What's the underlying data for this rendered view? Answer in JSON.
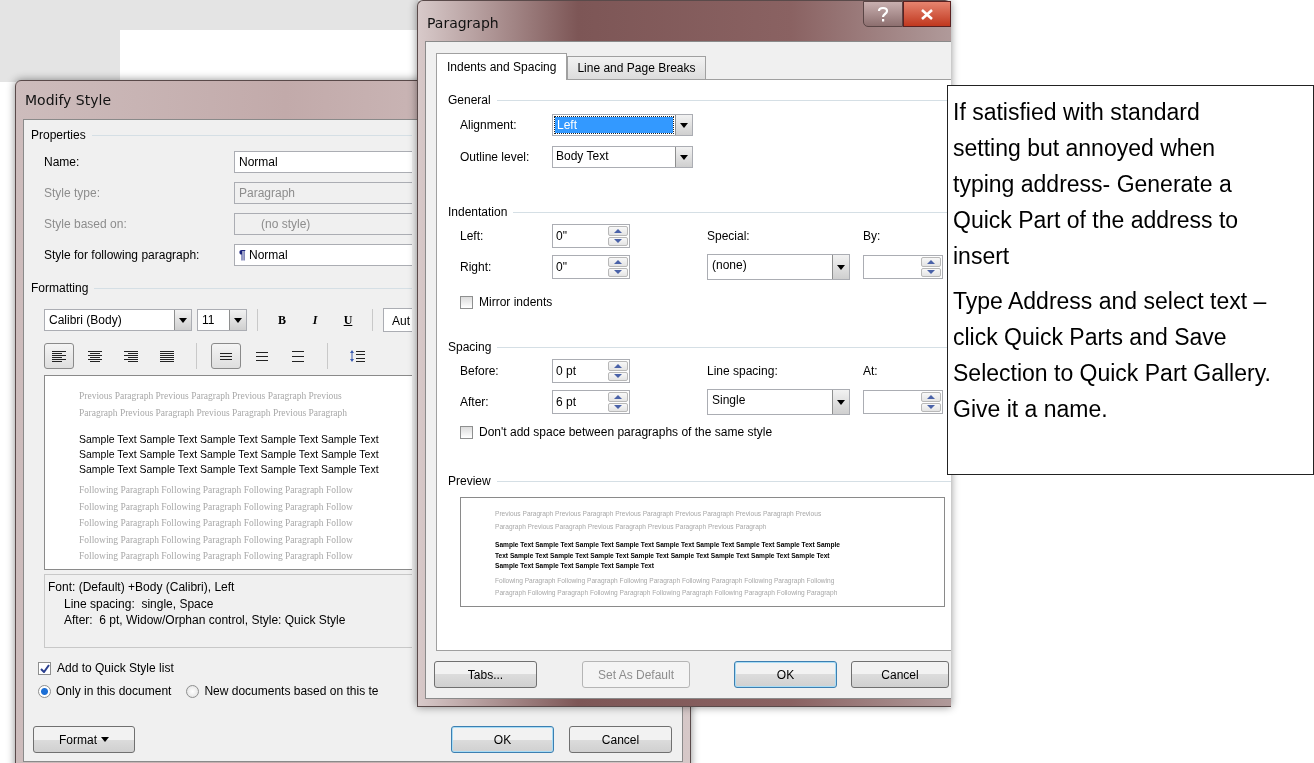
{
  "modify_style": {
    "title": "Modify Style",
    "properties_heading": "Properties",
    "fields": [
      {
        "label": "Name:",
        "value": "Normal",
        "disabled": false
      },
      {
        "label": "Style type:",
        "value": "Paragraph",
        "disabled": true
      },
      {
        "label": "Style based on:",
        "value": "(no style)",
        "disabled": true
      },
      {
        "label": "Style for following paragraph:",
        "mark": "¶",
        "value": "Normal",
        "disabled": false
      }
    ],
    "formatting_heading": "Formatting",
    "font": "Calibri (Body)",
    "size": "11",
    "format_buttons": [
      {
        "label": "B"
      },
      {
        "label": "I"
      },
      {
        "label": "U"
      }
    ],
    "color_field": "Aut",
    "align_buttons": [
      {
        "selected": true
      },
      {
        "selected": false
      },
      {
        "selected": false
      },
      {
        "selected": false
      }
    ],
    "spacing_buttons": [
      {
        "selected": true
      },
      {
        "selected": false
      },
      {
        "selected": false
      }
    ],
    "preview": {
      "previous": [
        "Previous Paragraph Previous Paragraph Previous Paragraph Previous",
        "Paragraph Previous Paragraph Previous Paragraph Previous Paragraph"
      ],
      "sample": [
        "Sample Text Sample Text Sample Text Sample Text Sample Text",
        "Sample Text Sample Text Sample Text Sample Text Sample Text",
        "Sample Text Sample Text Sample Text Sample Text Sample Text"
      ],
      "following": [
        "Following Paragraph Following Paragraph Following Paragraph Follow",
        "Following Paragraph Following Paragraph Following Paragraph Follow",
        "Following Paragraph Following Paragraph Following Paragraph Follow",
        "Following Paragraph Following Paragraph Following Paragraph Follow",
        "Following Paragraph Following Paragraph Following Paragraph Follow"
      ]
    },
    "description": [
      "Font: (Default) +Body (Calibri), Left",
      "Line spacing:  single, Space",
      "After:  6 pt, Widow/Orphan control, Style: Quick Style"
    ],
    "add_to_quick_style": {
      "label": "Add to Quick Style list",
      "checked": true
    },
    "radios": [
      {
        "label": "Only in this document",
        "selected": true
      },
      {
        "label": "New documents based on this te",
        "selected": false
      }
    ],
    "format_button": "Format",
    "buttons": [
      {
        "label": "OK",
        "default": true
      },
      {
        "label": "Cancel",
        "default": false
      }
    ]
  },
  "paragraph_dialog": {
    "title": "Paragraph",
    "tabs": [
      {
        "label": "Indents and Spacing",
        "selected": true
      },
      {
        "label": "Line and Page Breaks",
        "selected": false
      }
    ],
    "general": {
      "heading": "General",
      "rows": [
        {
          "label": "Alignment:",
          "value": "Left",
          "selected": true
        },
        {
          "label": "Outline level:",
          "value": "Body Text",
          "selected": false
        }
      ]
    },
    "indentation": {
      "heading": "Indentation",
      "rows": [
        {
          "label": "Left:",
          "value": "0\""
        },
        {
          "label": "Right:",
          "value": "0\""
        }
      ],
      "special": {
        "label": "Special:",
        "value": "(none)"
      },
      "by": {
        "label": "By:"
      }
    },
    "mirror_indents": {
      "label": "Mirror indents",
      "checked": false
    },
    "spacing": {
      "heading": "Spacing",
      "rows": [
        {
          "label": "Before:",
          "value": "0 pt"
        },
        {
          "label": "After:",
          "value": "6 pt"
        }
      ],
      "line_spacing": {
        "label": "Line spacing:",
        "value": "Single"
      },
      "at": {
        "label": "At:"
      }
    },
    "dont_add_space": {
      "label": "Don't add space between paragraphs of the same style",
      "checked": false
    },
    "preview": {
      "heading": "Preview",
      "previous": [
        "Previous Paragraph Previous Paragraph Previous Paragraph Previous Paragraph Previous Paragraph Previous",
        "Paragraph Previous Paragraph Previous Paragraph Previous Paragraph Previous Paragraph"
      ],
      "sample": [
        "Sample Text Sample Text Sample Text Sample Text Sample Text Sample Text Sample Text Sample Text Sample",
        "Text Sample Text Sample Text Sample Text Sample Text Sample Text Sample Text Sample Text Sample Text",
        "Sample Text Sample Text Sample Text Sample Text"
      ],
      "following": [
        "Following Paragraph Following Paragraph Following Paragraph Following Paragraph Following Paragraph Following",
        "Paragraph Following Paragraph Following Paragraph Following Paragraph Following Paragraph Following Paragraph"
      ]
    },
    "buttons": [
      {
        "label": "Tabs...",
        "disabled": false,
        "default": false
      },
      {
        "label": "Set As Default",
        "disabled": true,
        "default": false
      },
      {
        "label": "OK",
        "disabled": false,
        "default": true
      },
      {
        "label": "Cancel",
        "disabled": false,
        "default": false
      }
    ]
  },
  "note": {
    "paragraphs": [
      "If satisfied with standard setting but annoyed when typing address- Generate a Quick Part of the address to insert",
      "Type Address and select text – click Quick Parts and Save Selection to Quick Part Gallery. Give it a name."
    ]
  }
}
